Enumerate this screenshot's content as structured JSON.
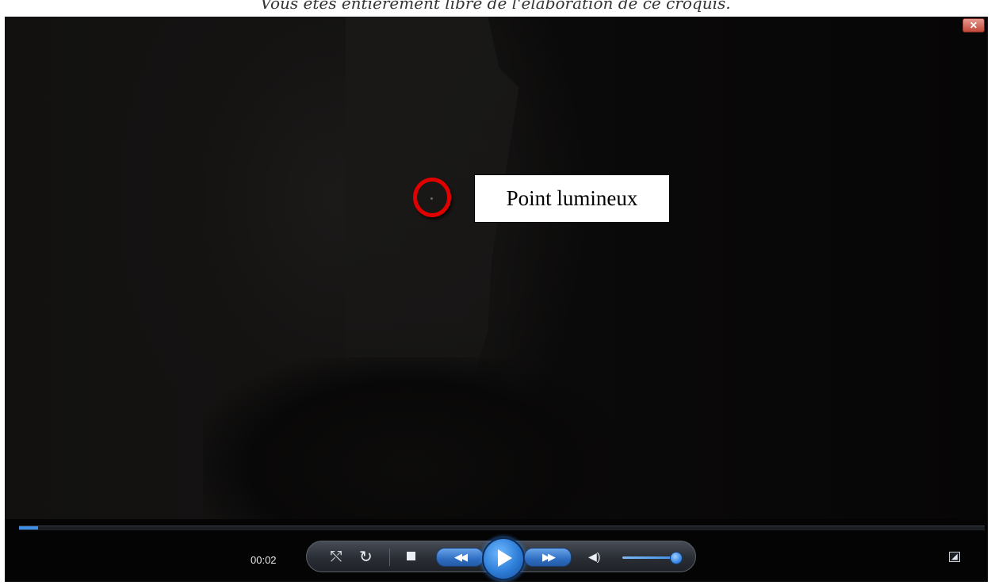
{
  "document": {
    "caption": "Vous êtes entièrement libre de l'élaboration de ce croquis."
  },
  "video": {
    "annotation_label": "Point lumineux",
    "annotation_color": "#e10000"
  },
  "window": {
    "close_icon": "close-icon",
    "close_glyph": "✕"
  },
  "player": {
    "elapsed_time": "00:02",
    "seek_progress_fraction": 0.02,
    "volume_level_fraction": 0.95,
    "accent_color": "#3f8fe6",
    "icons": {
      "shuffle": "⤲",
      "repeat": "↻",
      "previous": "◀◀",
      "next": "▶▶",
      "volume": "◀)",
      "mini_mode": "◢"
    }
  }
}
